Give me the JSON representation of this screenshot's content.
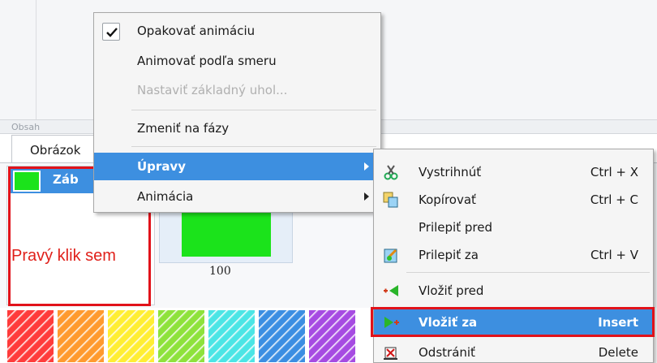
{
  "background": {
    "section_label": "Obsah",
    "tab_label": "Obrázok",
    "list_item_label": "Záb",
    "frame_value": "100",
    "palette_colors": [
      "#ff3b3b",
      "#ff9a2e",
      "#ffee33",
      "#8ee23b",
      "#4be5e5",
      "#3b8ee2",
      "#a64be2"
    ]
  },
  "annotation": {
    "text": "Pravý klik sem",
    "color": "#e1121a"
  },
  "context_menu": {
    "items": [
      {
        "label": "Opakovať animáciu",
        "checked": true
      },
      {
        "label": "Animovať podľa smeru"
      },
      {
        "label": "Nastaviť základný uhol...",
        "disabled": true
      },
      {
        "label": "Zmeniť na fázy"
      },
      {
        "label": "Úpravy",
        "submenu": true,
        "highlighted": true
      },
      {
        "label": "Animácia",
        "submenu": true
      }
    ]
  },
  "submenu": {
    "items": [
      {
        "label": "Vystrihnúť",
        "shortcut": "Ctrl + X",
        "icon": "scissors-icon"
      },
      {
        "label": "Kopírovať",
        "shortcut": "Ctrl + C",
        "icon": "copy-icon"
      },
      {
        "label": "Prilepiť pred",
        "shortcut": "",
        "icon": ""
      },
      {
        "label": "Prilepiť za",
        "shortcut": "Ctrl + V",
        "icon": "paste-icon"
      },
      {
        "label": "Vložiť pred",
        "shortcut": "",
        "icon": "insert-before-icon"
      },
      {
        "label": "Vložiť za",
        "shortcut": "Insert",
        "icon": "insert-after-icon",
        "highlighted": true
      },
      {
        "label": "Odstrániť",
        "shortcut": "Delete",
        "icon": "delete-icon"
      }
    ]
  },
  "colors": {
    "highlight": "#3d8fe0",
    "annotation_red": "#e1121a",
    "frame_green": "#1be31b"
  }
}
